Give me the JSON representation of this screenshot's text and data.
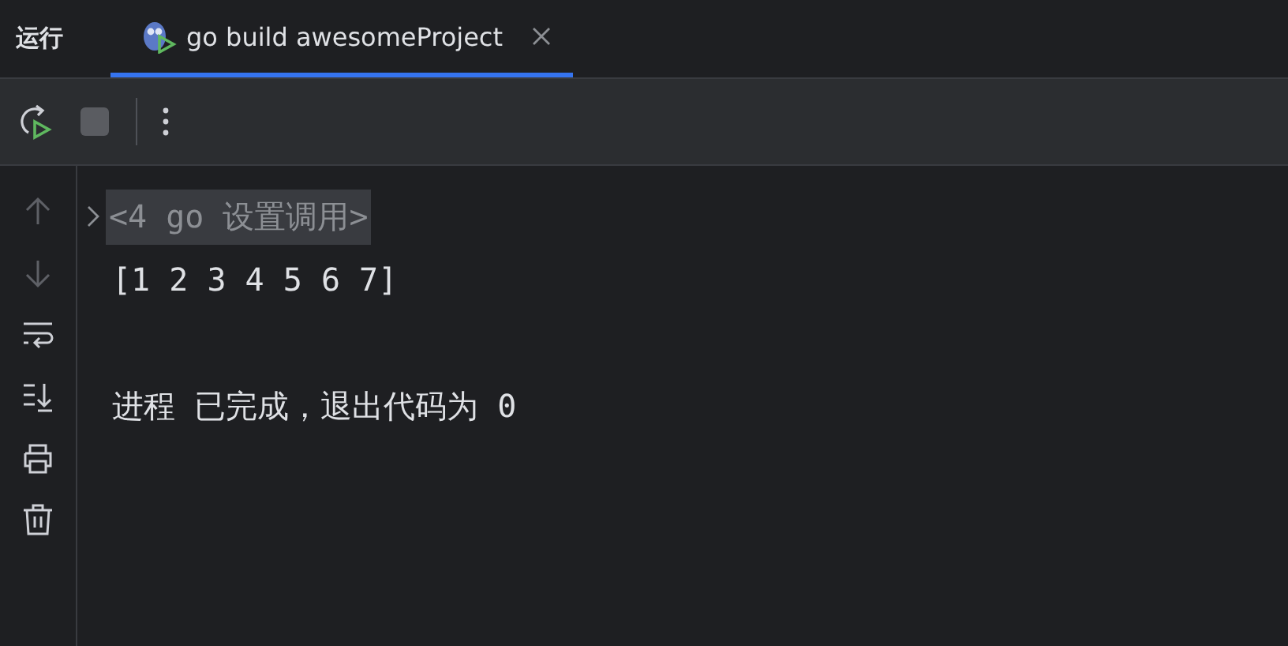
{
  "panel_title": "运行",
  "tabs": [
    {
      "label": "go build awesomeProject",
      "selected": true
    }
  ],
  "toolbar": [
    {
      "kind": "rerun"
    },
    {
      "kind": "stop",
      "disabled": true
    },
    {
      "kind": "separator"
    },
    {
      "kind": "more"
    }
  ],
  "sidebar": [
    {
      "kind": "up",
      "disabled": true
    },
    {
      "kind": "down",
      "disabled": true
    },
    {
      "kind": "wrap",
      "disabled": false
    },
    {
      "kind": "scroll-end",
      "disabled": false
    },
    {
      "kind": "print",
      "disabled": false
    },
    {
      "kind": "trash",
      "disabled": false
    }
  ],
  "console": [
    {
      "kind": "folded",
      "text": "<4 go 设置调用>"
    },
    {
      "kind": "output",
      "text": "[1 2 3 4 5 6 7]"
    },
    {
      "kind": "blank"
    },
    {
      "kind": "output",
      "text": "进程 已完成，退出代码为 0"
    }
  ]
}
